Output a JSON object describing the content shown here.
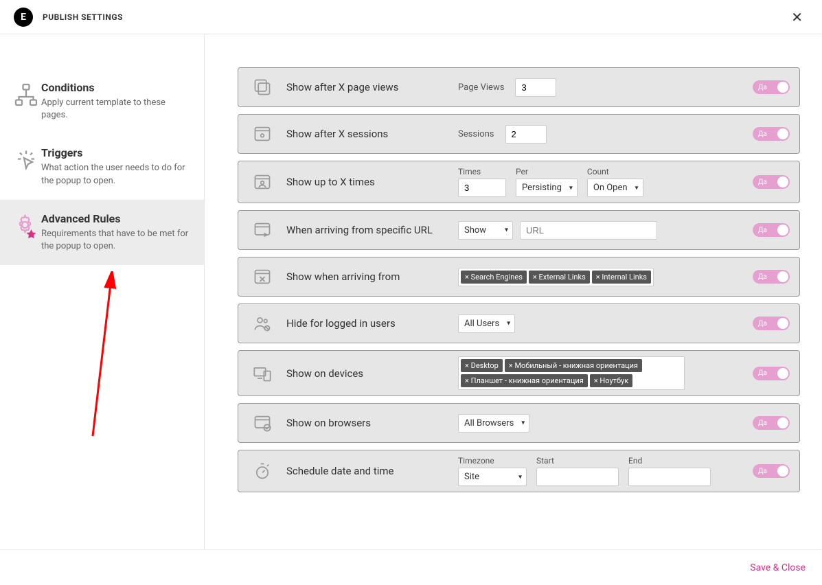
{
  "header": {
    "title": "PUBLISH SETTINGS"
  },
  "sidebar": {
    "items": [
      {
        "title": "Conditions",
        "desc": "Apply current template to these pages."
      },
      {
        "title": "Triggers",
        "desc": "What action the user needs to do for the popup to open."
      },
      {
        "title": "Advanced Rules",
        "desc": "Requirements that have to be met for the popup to open."
      }
    ]
  },
  "rules": {
    "page_views": {
      "title": "Show after X page views",
      "label": "Page Views",
      "value": "3"
    },
    "sessions": {
      "title": "Show after X sessions",
      "label": "Sessions",
      "value": "2"
    },
    "up_to": {
      "title": "Show up to X times",
      "times_label": "Times",
      "times_value": "3",
      "per_label": "Per",
      "per_value": "Persisting",
      "count_label": "Count",
      "count_value": "On Open"
    },
    "url": {
      "title": "When arriving from specific URL",
      "select_value": "Show",
      "placeholder": "URL"
    },
    "arriving_from": {
      "title": "Show when arriving from",
      "tags": [
        "× Search Engines",
        "× External Links",
        "× Internal Links"
      ]
    },
    "logged_in": {
      "title": "Hide for logged in users",
      "select_value": "All Users"
    },
    "devices": {
      "title": "Show on devices",
      "tags": [
        "× Desktop",
        "× Мобильный - книжная ориентация",
        "× Планшет - книжная ориентация",
        "× Ноутбук"
      ]
    },
    "browsers": {
      "title": "Show on browsers",
      "select_value": "All Browsers"
    },
    "schedule": {
      "title": "Schedule date and time",
      "tz_label": "Timezone",
      "tz_value": "Site",
      "start_label": "Start",
      "end_label": "End"
    }
  },
  "toggle_label": "Да",
  "footer": {
    "save": "Save & Close"
  }
}
